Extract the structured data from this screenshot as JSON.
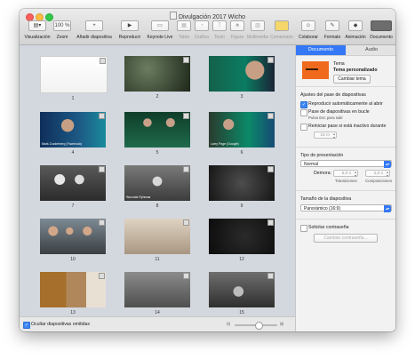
{
  "window": {
    "title": "Divulgación 2017 Wicho"
  },
  "toolbar": {
    "visualizacion": {
      "label": "Visualización",
      "icon": "sidebar-view-icon"
    },
    "zoom": {
      "label": "Zoom",
      "value": "100 %"
    },
    "add_slide": {
      "label": "Añadir diapositiva",
      "icon": "plus-icon"
    },
    "play": {
      "label": "Reproducir",
      "icon": "play-icon"
    },
    "keynote_live": {
      "label": "Keynote Live",
      "icon": "keynote-live-icon"
    },
    "table": {
      "label": "Tabla",
      "icon": "table-icon"
    },
    "chart": {
      "label": "Gráfica",
      "icon": "chart-icon"
    },
    "text": {
      "label": "Texto",
      "icon": "text-icon"
    },
    "shape": {
      "label": "Figura",
      "icon": "shape-icon"
    },
    "media": {
      "label": "Multimedia",
      "icon": "media-icon"
    },
    "comment": {
      "label": "Comentario",
      "icon": "comment-icon"
    },
    "collaborate": {
      "label": "Colaborar",
      "icon": "collaborate-icon"
    },
    "format": {
      "label": "Formato",
      "icon": "brush-icon"
    },
    "animation": {
      "label": "Animación",
      "icon": "diamond-icon"
    },
    "document": {
      "label": "Documento",
      "icon": "document-icon"
    }
  },
  "slides": [
    {
      "num": "1",
      "caption": ""
    },
    {
      "num": "2",
      "caption": ""
    },
    {
      "num": "3",
      "caption": ""
    },
    {
      "num": "4",
      "caption": "Mark Zuckerberg (Facebook)"
    },
    {
      "num": "5",
      "caption": ""
    },
    {
      "num": "6",
      "caption": "Larry Page (Google)"
    },
    {
      "num": "7",
      "caption": ""
    },
    {
      "num": "8",
      "caption": "Wozniak Ryhmaa"
    },
    {
      "num": "9",
      "caption": ""
    },
    {
      "num": "10",
      "caption": ""
    },
    {
      "num": "11",
      "caption": ""
    },
    {
      "num": "12",
      "caption": ""
    },
    {
      "num": "13",
      "caption": ""
    },
    {
      "num": "14",
      "caption": ""
    },
    {
      "num": "15",
      "caption": ""
    }
  ],
  "footer": {
    "hide_skipped_label": "Ocultar diapositivas omitidas",
    "hide_skipped_checked": true
  },
  "inspector": {
    "tabs": [
      "Documento",
      "Audio"
    ],
    "active_tab": "Documento",
    "theme": {
      "heading": "Tema",
      "name": "Tema personalizado",
      "change_button": "Cambiar tema",
      "swatch_color": "#f06a1d"
    },
    "slideshow": {
      "heading": "Ajustes del pase de diapositivas",
      "autoplay_label": "Reproducir automáticamente al abrir",
      "autoplay_checked": true,
      "loop_label": "Pase de diapositivas en bucle",
      "loop_checked": false,
      "esc_hint": "Pulsa Esc para salir",
      "restart_label": "Reiniciar pase si está inactivo durante",
      "restart_checked": false,
      "restart_value": "15 m"
    },
    "presentation": {
      "heading": "Tipo de presentación",
      "type_value": "Normal",
      "delay_label": "Demora:",
      "transitions_value": "5,0 s",
      "builds_value": "2,0 s",
      "transitions_label": "Transiciones",
      "builds_label": "Composiciones"
    },
    "size": {
      "heading": "Tamaño de la diapositiva",
      "value": "Panorámico (16:9)"
    },
    "password": {
      "require_label": "Solicitar contraseña",
      "require_checked": false,
      "change_button": "Cambiar contraseña..."
    }
  },
  "accent_color": "#3478f6"
}
